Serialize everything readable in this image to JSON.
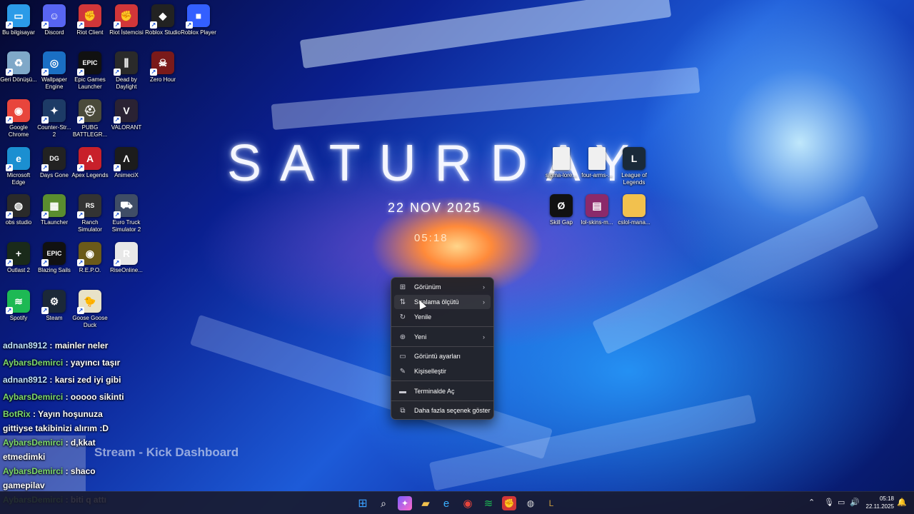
{
  "wallpaper": {
    "title": "SATURDAY",
    "date": "22 NOV 2025",
    "time": "05:18"
  },
  "desktop_icons": [
    {
      "label": "Bu bilgisayar",
      "icon": "computer-icon",
      "color": "#2b9be8",
      "glyph": "▭"
    },
    {
      "label": "Discord",
      "icon": "discord-icon",
      "color": "#5865f2",
      "glyph": "☺"
    },
    {
      "label": "Riot Client",
      "icon": "riot-icon",
      "color": "#d13639",
      "glyph": "✊"
    },
    {
      "label": "Riot İstemcisi",
      "icon": "riot-icon",
      "color": "#d13639",
      "glyph": "✊"
    },
    {
      "label": "Roblox Studio",
      "icon": "roblox-studio-icon",
      "color": "#222222",
      "glyph": "◆"
    },
    {
      "label": "Roblox Player",
      "icon": "roblox-icon",
      "color": "#335fff",
      "glyph": "■"
    },
    {
      "label": "Geri Dönüşü...",
      "icon": "recycle-bin-icon",
      "color": "#7fa8c8",
      "glyph": "♻"
    },
    {
      "label": "Wallpaper Engine",
      "icon": "wallpaper-engine-icon",
      "color": "#1a6fc4",
      "glyph": "◎"
    },
    {
      "label": "Epic Games Launcher",
      "icon": "epic-games-icon",
      "color": "#111111",
      "glyph": "EPIC"
    },
    {
      "label": "Dead by Daylight",
      "icon": "dead-by-daylight-icon",
      "color": "#2a2a2a",
      "glyph": "⫼"
    },
    {
      "label": "Zero Hour",
      "icon": "zero-hour-icon",
      "color": "#7a1a1a",
      "glyph": "☠"
    },
    {
      "label": "Google Chrome",
      "icon": "chrome-icon",
      "color": "#e8453c",
      "glyph": "◉"
    },
    {
      "label": "Counter-Str... 2",
      "icon": "counter-strike-icon",
      "color": "#1d3b66",
      "glyph": "✦"
    },
    {
      "label": "PUBG BATTLEGR...",
      "icon": "pubg-icon",
      "color": "#4a4a3a",
      "glyph": "⛑"
    },
    {
      "label": "VALORANT",
      "icon": "valorant-icon",
      "color": "#2a2233",
      "glyph": "V"
    },
    {
      "label": "Microsoft Edge",
      "icon": "edge-icon",
      "color": "#1b8fd1",
      "glyph": "e"
    },
    {
      "label": "Days Gone",
      "icon": "days-gone-icon",
      "color": "#222222",
      "glyph": "DG"
    },
    {
      "label": "Apex Legends",
      "icon": "apex-icon",
      "color": "#c8202a",
      "glyph": "A"
    },
    {
      "label": "AnimeciX",
      "icon": "animecix-icon",
      "color": "#1c1c1c",
      "glyph": "Λ"
    },
    {
      "label": "obs studio",
      "icon": "obs-icon",
      "color": "#2a2a2a",
      "glyph": "◍"
    },
    {
      "label": "TLauncher",
      "icon": "tlauncher-icon",
      "color": "#5a8d2f",
      "glyph": "▦"
    },
    {
      "label": "Ranch Simulator",
      "icon": "ranch-simulator-icon",
      "color": "#333333",
      "glyph": "RS"
    },
    {
      "label": "Euro Truck Simulator 2",
      "icon": "euro-truck-icon",
      "color": "#3f4d66",
      "glyph": "⛟"
    },
    {
      "label": "Outlast 2",
      "icon": "outlast-icon",
      "color": "#1a2a1a",
      "glyph": "+"
    },
    {
      "label": "Blazing Sails",
      "icon": "epic-games-icon",
      "color": "#111111",
      "glyph": "EPIC"
    },
    {
      "label": "R.E.P.O.",
      "icon": "repo-icon",
      "color": "#6b5a1a",
      "glyph": "◉"
    },
    {
      "label": "RiseOnline...",
      "icon": "rise-online-icon",
      "color": "#e8e8e8",
      "glyph": "R"
    },
    {
      "label": "Spotify",
      "icon": "spotify-icon",
      "color": "#1db954",
      "glyph": "≋"
    },
    {
      "label": "Steam",
      "icon": "steam-icon",
      "color": "#1b2838",
      "glyph": "⚙"
    },
    {
      "label": "Goose Goose Duck",
      "icon": "goose-duck-icon",
      "color": "#e8e2c8",
      "glyph": "🐤"
    }
  ],
  "right_icons": [
    {
      "label": "sigma-lore...",
      "icon": "file-icon",
      "color": "#f0f0f0",
      "glyph": ""
    },
    {
      "label": "four-arms-...",
      "icon": "file-icon",
      "color": "#f0f0f0",
      "glyph": ""
    },
    {
      "label": "League of Legends",
      "icon": "league-icon",
      "color": "#1a2a3a",
      "glyph": "L"
    },
    {
      "label": "Skill Gap",
      "icon": "skill-gap-icon",
      "color": "#111111",
      "glyph": "Ø"
    },
    {
      "label": "lol-skins-m...",
      "icon": "winrar-icon",
      "color": "#8b2a6b",
      "glyph": "▤"
    },
    {
      "label": "cslol-mana...",
      "icon": "folder-icon",
      "color": "#f2c14e",
      "glyph": ""
    }
  ],
  "chat": [
    {
      "user": "adnan8912",
      "text": " : mainler neler",
      "hl": false
    },
    {
      "user": "AybarsDemirci",
      "text": " : yayıncı taşır",
      "hl": true
    },
    {
      "user": "adnan8912",
      "text": " : karsi zed iyi gibi",
      "hl": false
    },
    {
      "user": "AybarsDemirci",
      "text": " : ooooo sikinti",
      "hl": true
    },
    {
      "user": "BotRix",
      "text": " : Yayın hoşunuza",
      "hl": true
    },
    {
      "user": "",
      "text": "gittiyse takibinizi alırım :D",
      "hl": false
    },
    {
      "user": "AybarsDemirci",
      "text": " : d,kkat",
      "hl": true
    },
    {
      "user": "",
      "text": "etmedimki",
      "hl": false
    },
    {
      "user": "AybarsDemirci",
      "text": " : shaco",
      "hl": true
    },
    {
      "user": "",
      "text": "gamepilav",
      "hl": false
    },
    {
      "user": "AybarsDemirci",
      "text": " : biti q attı",
      "hl": true
    }
  ],
  "watermark": "Stream - Kick Dashboard",
  "context_menu": {
    "view": "Görünüm",
    "sort": "Sıralama ölçütü",
    "refresh": "Yenile",
    "new": "Yeni",
    "display": "Görüntü ayarları",
    "personalize": "Kişiselleştir",
    "terminal": "Terminalde Aç",
    "more": "Daha fazla seçenek göster"
  },
  "taskbar": {
    "time": "05:18",
    "date": "22.11.2025"
  }
}
